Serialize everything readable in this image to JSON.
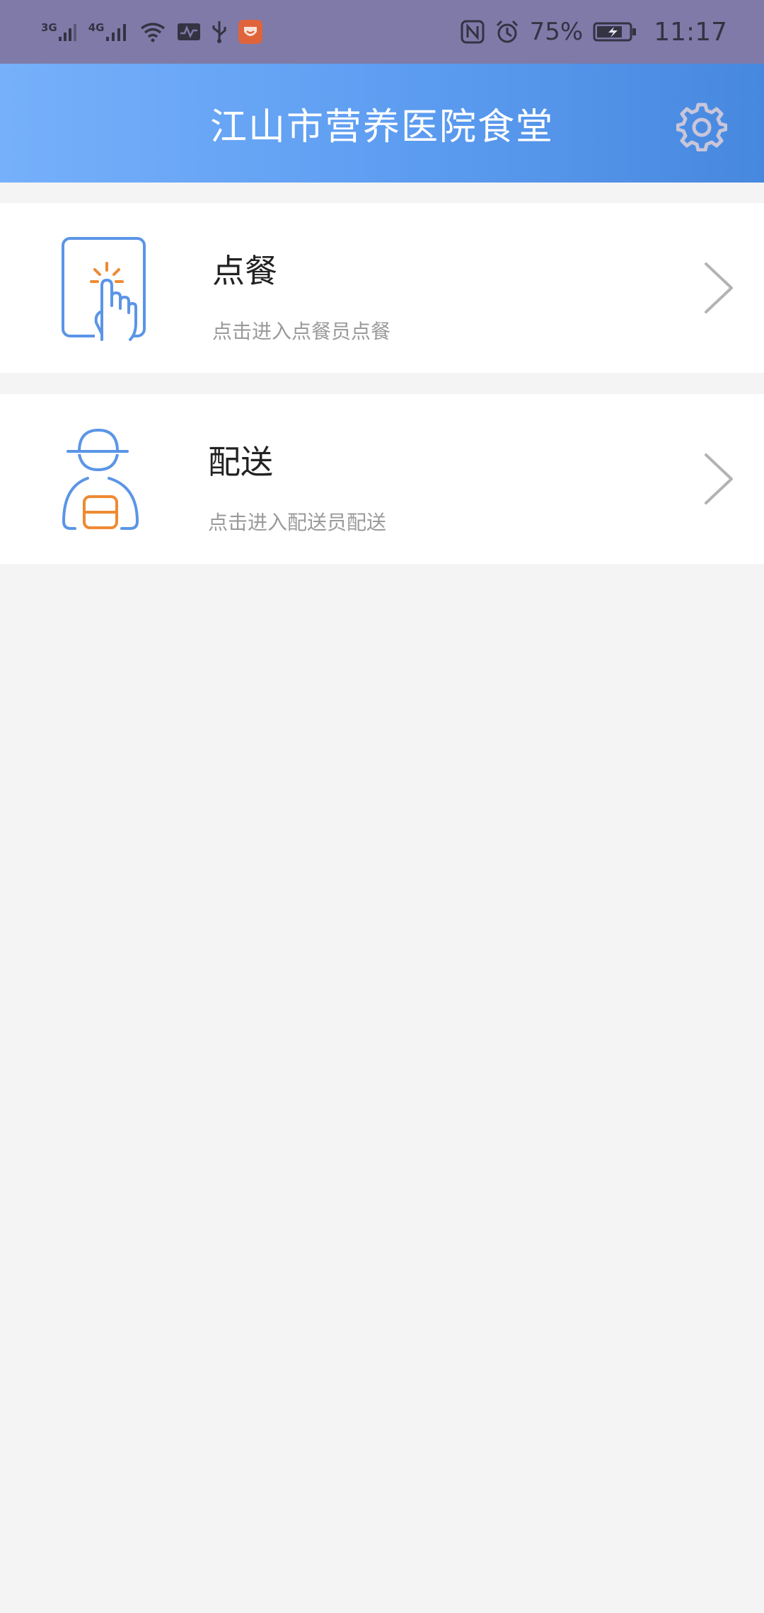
{
  "status_bar": {
    "net1": "3G",
    "net2": "4G",
    "battery_percent": "75%",
    "time": "11:17"
  },
  "header": {
    "title": "江山市营养医院食堂",
    "settings_icon": "gear-icon"
  },
  "menu": {
    "items": [
      {
        "title": "点餐",
        "subtitle": "点击进入点餐员点餐",
        "icon": "tap-order-icon"
      },
      {
        "title": "配送",
        "subtitle": "点击进入配送员配送",
        "icon": "courier-icon"
      }
    ]
  },
  "colors": {
    "status_bar_bg": "#7f7aa8",
    "header_gradient_start": "#76b0fb",
    "header_gradient_end": "#4788df",
    "icon_blue": "#5b95e6",
    "icon_orange": "#ee8a33",
    "page_bg": "#f4f4f4"
  }
}
